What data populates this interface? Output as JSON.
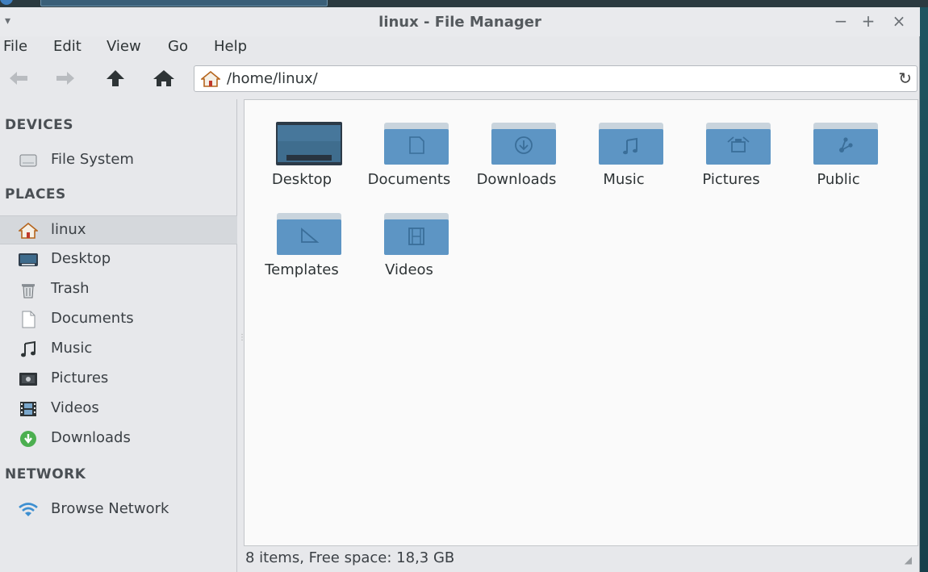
{
  "window": {
    "title": "linux - File Manager",
    "menu_glyph": "▾",
    "minimize": "−",
    "maximize": "+",
    "close": "×"
  },
  "menubar": [
    "File",
    "Edit",
    "View",
    "Go",
    "Help"
  ],
  "toolbar": {
    "buttons": [
      "back-icon",
      "forward-icon",
      "up-icon",
      "home-icon"
    ],
    "location": "/home/linux/",
    "reload_glyph": "↻"
  },
  "sidebar": {
    "devices_label": "DEVICES",
    "devices": [
      {
        "label": "File System",
        "icon": "drive-icon"
      }
    ],
    "places_label": "PLACES",
    "places": [
      {
        "label": "linux",
        "icon": "home-icon",
        "selected": true
      },
      {
        "label": "Desktop",
        "icon": "desktop-icon"
      },
      {
        "label": "Trash",
        "icon": "trash-icon"
      },
      {
        "label": "Documents",
        "icon": "document-icon"
      },
      {
        "label": "Music",
        "icon": "music-icon"
      },
      {
        "label": "Pictures",
        "icon": "picture-icon"
      },
      {
        "label": "Videos",
        "icon": "video-icon"
      },
      {
        "label": "Downloads",
        "icon": "download-icon"
      }
    ],
    "network_label": "NETWORK",
    "network": [
      {
        "label": "Browse Network",
        "icon": "wifi-icon"
      }
    ]
  },
  "files": [
    {
      "name": "Desktop",
      "icon": "desktop-folder-icon"
    },
    {
      "name": "Documents",
      "icon": "documents-folder-icon"
    },
    {
      "name": "Downloads",
      "icon": "downloads-folder-icon"
    },
    {
      "name": "Music",
      "icon": "music-folder-icon"
    },
    {
      "name": "Pictures",
      "icon": "pictures-folder-icon"
    },
    {
      "name": "Public",
      "icon": "public-folder-icon"
    },
    {
      "name": "Templates",
      "icon": "templates-folder-icon"
    },
    {
      "name": "Videos",
      "icon": "videos-folder-icon"
    }
  ],
  "status": "8 items, Free space: 18,3 GB",
  "colors": {
    "folder_body": "#5d95c4",
    "folder_tab": "#c9d4dd",
    "accent_green": "#4caf50"
  }
}
